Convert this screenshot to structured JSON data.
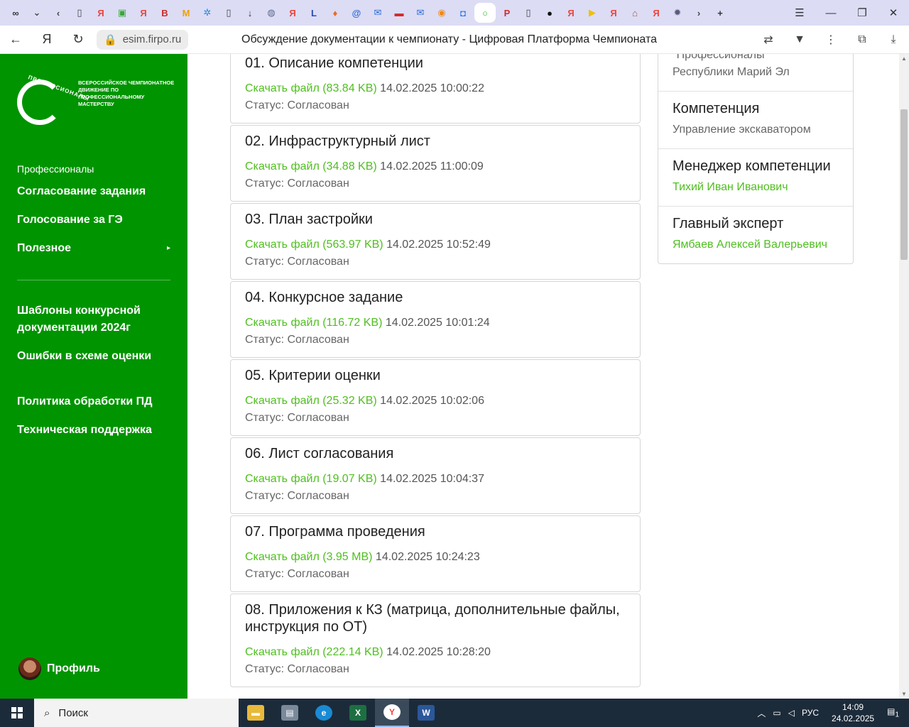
{
  "browser": {
    "tab_icons": [
      {
        "name": "infinity-tab-icon",
        "glyph": "∞",
        "color": "#333333"
      },
      {
        "name": "chevron-down-icon",
        "glyph": "⌄",
        "color": "#444444"
      },
      {
        "name": "chevron-left-icon",
        "glyph": "‹",
        "color": "#444444"
      },
      {
        "name": "document-tab-icon",
        "glyph": "▯",
        "color": "#444444"
      },
      {
        "name": "yandex-tab-icon",
        "glyph": "Я",
        "color": "#f0443a"
      },
      {
        "name": "image-tab-icon",
        "glyph": "▣",
        "color": "#3aa63a"
      },
      {
        "name": "yandex-tab-icon",
        "glyph": "Я",
        "color": "#f0443a"
      },
      {
        "name": "vk-tab-icon",
        "glyph": "В",
        "color": "#d12a2a"
      },
      {
        "name": "mobile-tab-icon",
        "glyph": "М",
        "color": "#f0a000"
      },
      {
        "name": "swirl-tab-icon",
        "glyph": "✲",
        "color": "#2a8ad4"
      },
      {
        "name": "document-tab-icon",
        "glyph": "▯",
        "color": "#444444"
      },
      {
        "name": "download-tab-icon",
        "glyph": "↓",
        "color": "#333333"
      },
      {
        "name": "globe-tab-icon",
        "glyph": "◍",
        "color": "#5a6a8a"
      },
      {
        "name": "yandex-tab-icon",
        "glyph": "Я",
        "color": "#f0443a"
      },
      {
        "name": "list-tab-icon",
        "glyph": "L",
        "color": "#2a4ab4"
      },
      {
        "name": "flame-tab-icon",
        "glyph": "♦",
        "color": "#f06a1a"
      },
      {
        "name": "at-tab-icon",
        "glyph": "@",
        "color": "#2a6ad4"
      },
      {
        "name": "mail-tab-icon",
        "glyph": "✉",
        "color": "#2a6ad4"
      },
      {
        "name": "flag-tab-icon",
        "glyph": "▬",
        "color": "#d42a2a"
      },
      {
        "name": "mail-tab-icon",
        "glyph": "✉",
        "color": "#2a6ad4"
      },
      {
        "name": "blender-tab-icon",
        "glyph": "◉",
        "color": "#f08a1a"
      },
      {
        "name": "square-tab-icon",
        "glyph": "◘",
        "color": "#2a7ae4"
      },
      {
        "name": "ring-tab-icon",
        "glyph": "○",
        "color": "#3ab43a"
      },
      {
        "name": "pdf-tab-icon",
        "glyph": "P",
        "color": "#d42a2a"
      },
      {
        "name": "document-tab-icon",
        "glyph": "▯",
        "color": "#444444"
      },
      {
        "name": "circle-tab-icon",
        "glyph": "●",
        "color": "#111111"
      },
      {
        "name": "yandex-tab-icon",
        "glyph": "Я",
        "color": "#f0443a"
      },
      {
        "name": "play-tab-icon",
        "glyph": "▶",
        "color": "#f0c000"
      },
      {
        "name": "yandex-tab-icon",
        "glyph": "Я",
        "color": "#f0443a"
      },
      {
        "name": "house-tab-icon",
        "glyph": "⌂",
        "color": "#a05a3a"
      },
      {
        "name": "yandex-tab-icon",
        "glyph": "Я",
        "color": "#f0443a"
      },
      {
        "name": "gear-tab-icon",
        "glyph": "✹",
        "color": "#5a5a7a"
      },
      {
        "name": "chevron-right-icon",
        "glyph": "›",
        "color": "#444444"
      },
      {
        "name": "new-tab-icon",
        "glyph": "+",
        "color": "#333333"
      }
    ],
    "url": "esim.firpo.ru",
    "page_title": "Обсуждение документации к чемпионату - Цифровая Платформа Чемпионата"
  },
  "sidebar": {
    "logo_arc": "ПРОФЕССИОНАЛЫ",
    "logo_text": "ВСЕРОССИЙСКОЕ ЧЕМПИОНАТНОЕ ДВИЖЕНИЕ ПО ПРОФЕССИОНАЛЬНОМУ МАСТЕРСТВУ",
    "section_label": "Профессионалы",
    "items": [
      {
        "label": "Согласование задания"
      },
      {
        "label": "Голосование за ГЭ"
      },
      {
        "label": "Полезное"
      },
      {
        "label": "Шаблоны конкурсной документации 2024г"
      },
      {
        "label": "Ошибки в схеме оценки"
      },
      {
        "label": "Политика обработки ПД"
      },
      {
        "label": "Техническая поддержка"
      }
    ],
    "profile_label": "Профиль"
  },
  "documents": [
    {
      "title": "01. Описание компетенции",
      "link": "Скачать файл (83.84 KB)",
      "date": "14.02.2025 10:00:22",
      "status": "Статус: Согласован"
    },
    {
      "title": "02. Инфраструктурный лист",
      "link": "Скачать файл (34.88 KB)",
      "date": "14.02.2025 11:00:09",
      "status": "Статус: Согласован"
    },
    {
      "title": "03. План застройки",
      "link": "Скачать файл (563.97 KB)",
      "date": "14.02.2025 10:52:49",
      "status": "Статус: Согласован"
    },
    {
      "title": "04. Конкурсное задание",
      "link": "Скачать файл (116.72 KB)",
      "date": "14.02.2025 10:01:24",
      "status": "Статус: Согласован"
    },
    {
      "title": "05. Критерии оценки",
      "link": "Скачать файл (25.32 KB)",
      "date": "14.02.2025 10:02:06",
      "status": "Статус: Согласован"
    },
    {
      "title": "06. Лист согласования",
      "link": "Скачать файл (19.07 KB)",
      "date": "14.02.2025 10:04:37",
      "status": "Статус: Согласован"
    },
    {
      "title": "07. Программа проведения",
      "link": "Скачать файл (3.95 MB)",
      "date": "14.02.2025 10:24:23",
      "status": "Статус: Согласован"
    },
    {
      "title": "08. Приложения к КЗ (матрица, дополнительные файлы, инструкция по ОТ)",
      "link": "Скачать файл (222.14 KB)",
      "date": "14.02.2025 10:28:20",
      "status": "Статус: Согласован"
    }
  ],
  "info": {
    "top_text_1": "\"Профессионалы\"",
    "top_text_2": "Республики Марий Эл",
    "competence_label": "Компетенция",
    "competence_value": "Управление экскаватором",
    "manager_label": "Менеджер компетенции",
    "manager_value": "Тихий Иван Иванович",
    "expert_label": "Главный эксперт",
    "expert_value": "Ямбаев Алексей Валерьевич"
  },
  "taskbar": {
    "search_label": "Поиск",
    "lang": "РУС",
    "time": "14:09",
    "date": "24.02.2025",
    "notification_count": "1"
  },
  "colors": {
    "sidebar_green": "#009400",
    "link_green": "#4fbf1f",
    "tab_strip": "#dcdcf5",
    "taskbar": "#1c2b3a"
  }
}
